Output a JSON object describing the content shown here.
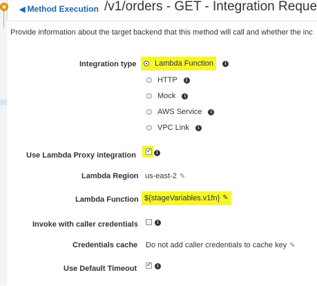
{
  "header": {
    "back_label": "Method Execution",
    "title": "/v1/orders - GET - Integration Request"
  },
  "description": "Provide information about the target backend that this method will call and whether the inc",
  "integration": {
    "label": "Integration type",
    "options": [
      {
        "label": "Lambda Function",
        "selected": true
      },
      {
        "label": "HTTP",
        "selected": false
      },
      {
        "label": "Mock",
        "selected": false
      },
      {
        "label": "AWS Service",
        "selected": false
      },
      {
        "label": "VPC Link",
        "selected": false
      }
    ]
  },
  "proxy": {
    "label": "Use Lambda Proxy integration",
    "checked": true
  },
  "region": {
    "label": "Lambda Region",
    "value": "us-east-2"
  },
  "function": {
    "label": "Lambda Function",
    "value": "${stageVariables.v1fn}"
  },
  "invoke": {
    "label": "Invoke with caller credentials",
    "checked": false
  },
  "cache": {
    "label": "Credentials cache",
    "value": "Do not add caller credentials to cache key"
  },
  "timeout": {
    "label": "Use Default Timeout",
    "checked": true
  },
  "colors": {
    "link": "#1a66b3",
    "highlight": "#f6f629",
    "accent": "#f0a020"
  }
}
